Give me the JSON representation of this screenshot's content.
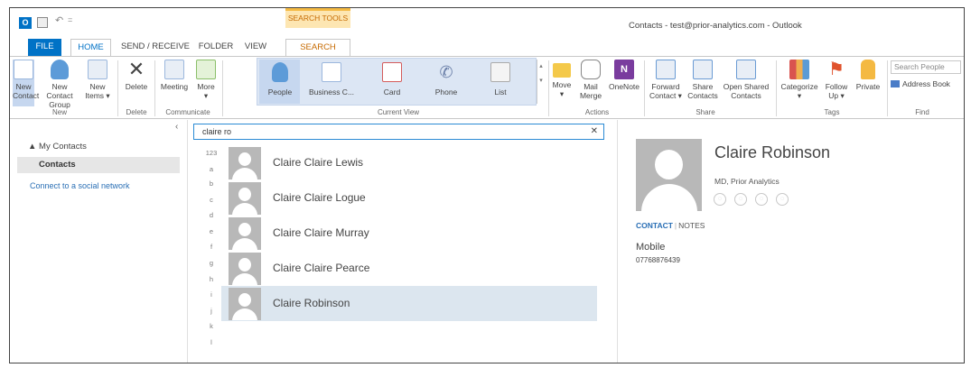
{
  "window": {
    "title": "Contacts - test@prior-analytics.com - Outlook",
    "context_tab_group": "SEARCH TOOLS",
    "quick_access": {
      "logo": "O",
      "undo": "↶",
      "more": "="
    }
  },
  "tabs": [
    "FILE",
    "HOME",
    "SEND / RECEIVE",
    "FOLDER",
    "VIEW",
    "SEARCH"
  ],
  "ribbon": {
    "new": {
      "new_contact": [
        "New",
        "Contact"
      ],
      "new_contact_group": [
        "New Contact",
        "Group"
      ],
      "new_items": [
        "New",
        "Items ▾"
      ],
      "label": "New"
    },
    "delete": {
      "button": "Delete",
      "label": "Delete"
    },
    "communicate": {
      "meeting": "Meeting",
      "more": [
        "More",
        "▾"
      ],
      "label": "Communicate"
    },
    "current_view": {
      "people": "People",
      "business_card": "Business C...",
      "card": "Card",
      "phone": "Phone",
      "list": "List",
      "label": "Current View"
    },
    "actions": {
      "move": [
        "Move",
        "▾"
      ],
      "mail_merge": [
        "Mail",
        "Merge"
      ],
      "onenote": "OneNote",
      "label": "Actions"
    },
    "share": {
      "forward": [
        "Forward",
        "Contact ▾"
      ],
      "share_contacts": [
        "Share",
        "Contacts"
      ],
      "open_shared": [
        "Open Shared",
        "Contacts"
      ],
      "label": "Share"
    },
    "tags": {
      "categorize": [
        "Categorize",
        "▾"
      ],
      "follow_up": [
        "Follow",
        "Up ▾"
      ],
      "private": "Private",
      "label": "Tags"
    },
    "find": {
      "search_placeholder": "Search People",
      "address_book": "Address Book",
      "label": "Find"
    }
  },
  "folder_pane": {
    "collapse": "‹",
    "group": "▲ My Contacts",
    "selected_folder": "Contacts",
    "social_link": "Connect to a social network"
  },
  "search": {
    "query": "claire ro",
    "clear": "✕"
  },
  "alphabet": [
    "123",
    "a",
    "b",
    "c",
    "d",
    "e",
    "f",
    "g",
    "h",
    "i",
    "j",
    "k",
    "l"
  ],
  "contacts": [
    {
      "name": "Claire Claire Lewis"
    },
    {
      "name": "Claire Claire Logue"
    },
    {
      "name": "Claire Claire Murray"
    },
    {
      "name": "Claire Claire Pearce"
    },
    {
      "name": "Claire Robinson",
      "selected": true
    }
  ],
  "detail": {
    "name": "Claire Robinson",
    "title": "MD, Prior Analytics",
    "tab_contact": "CONTACT",
    "tab_notes": "NOTES",
    "tab_separator": "|",
    "mobile_label": "Mobile",
    "mobile_value": "07768876439",
    "action_icons": [
      "instant-message-icon",
      "call-icon",
      "video-icon",
      "email-icon"
    ]
  },
  "colors": {
    "accent": "#0072c6",
    "selection": "#dce6ef",
    "search_tools": "#fde6b2",
    "link": "#2a6fb5"
  }
}
